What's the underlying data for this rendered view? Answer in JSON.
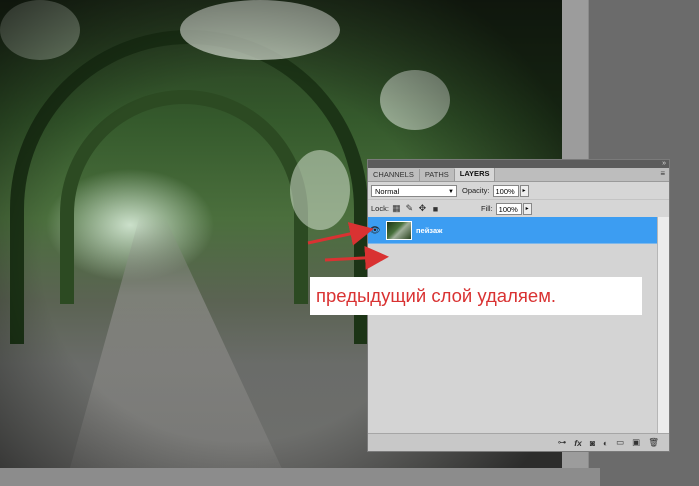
{
  "panel": {
    "tabs": [
      "CHANNELS",
      "PATHS",
      "LAYERS"
    ],
    "collapse_icon": "»",
    "menu_icon": "≡",
    "blend_mode": "Normal",
    "opacity_label": "Opacity:",
    "opacity_value": "100%",
    "lock_label": "Lock:",
    "fill_label": "Fill:",
    "fill_value": "100%",
    "layer_name": "пейзаж",
    "footer_icons": [
      "link-icon",
      "fx-icon",
      "mask-icon",
      "adjustment-icon",
      "group-icon",
      "new-layer-icon",
      "trash-icon"
    ]
  },
  "annotation": {
    "text": "предыдущий слой удаляем.",
    "color": "#d93232"
  },
  "colors": {
    "selected_layer": "#3c9df2",
    "arrow": "#d93232"
  }
}
